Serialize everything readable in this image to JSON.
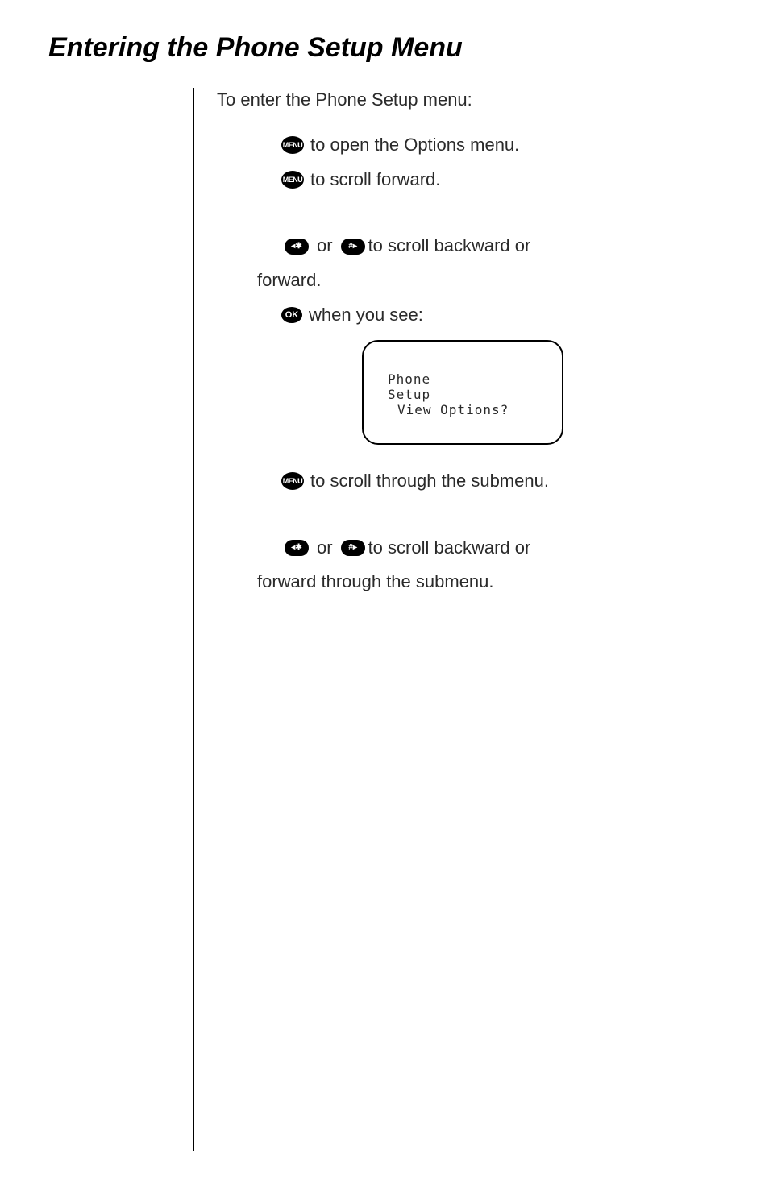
{
  "title": "Entering the Phone Setup Menu",
  "intro": "To enter the Phone Setup menu:",
  "buttons": {
    "menu": "MENU",
    "ok": "OK",
    "leftStar": "◂✱",
    "hashRight": "#▸"
  },
  "steps": {
    "s1": " to open the Options menu.",
    "s2": " to scroll forward.",
    "s3a": " or ",
    "s3b": " to scroll backward or",
    "s3c": "forward.",
    "s4": " when you see:",
    "s5": " to scroll through the submenu.",
    "s6a": " or ",
    "s6b": " to scroll backward or",
    "s6c": "forward through the submenu."
  },
  "screen": {
    "line1": "Phone",
    "line2": "Setup",
    "line3": "View Options?"
  }
}
